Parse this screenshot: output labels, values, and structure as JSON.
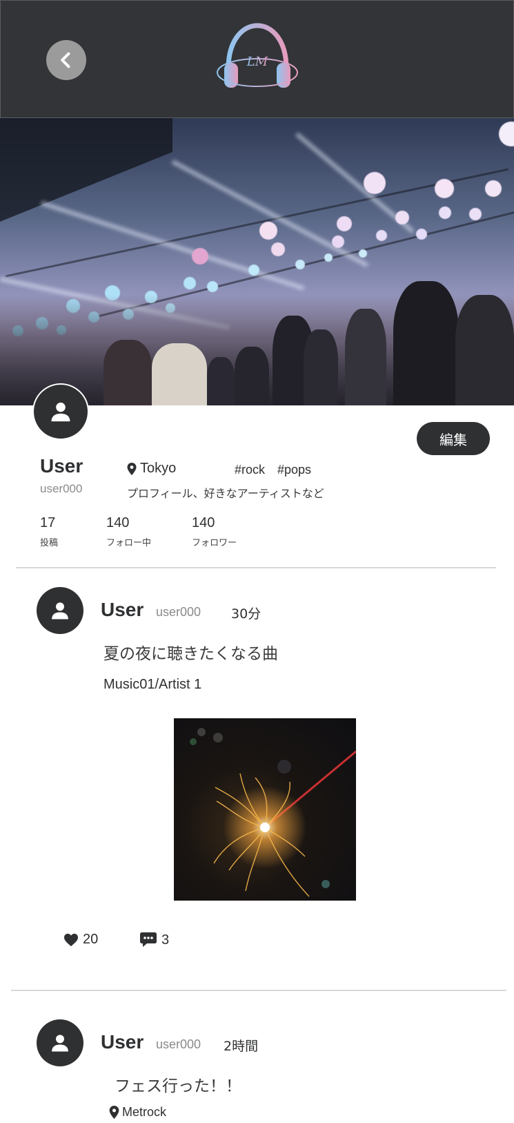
{
  "header": {
    "back_icon": "chevron-left-icon",
    "logo_text": "LM",
    "logo_colors": {
      "blue": "#8ec5f0",
      "pink": "#e79bbd"
    }
  },
  "colors": {
    "header_bg": "#323437",
    "dark": "#2f3032",
    "muted": "#8a8a8a",
    "divider": "#d8d8d8"
  },
  "profile": {
    "name": "User",
    "handle": "user000",
    "location": "Tokyo",
    "tags": [
      "#rock",
      "#pops"
    ],
    "bio": "プロフィール、好きなアーティストなど",
    "edit_label": "編集",
    "stats": [
      {
        "value": "17",
        "label": "投稿"
      },
      {
        "value": "140",
        "label": "フォロー中"
      },
      {
        "value": "140",
        "label": "フォロワー"
      }
    ]
  },
  "posts": [
    {
      "name": "User",
      "handle": "user000",
      "time": "30分",
      "text": "夏の夜に聴きたくなる曲",
      "music": "Music01/Artist 1",
      "likes": "20",
      "comments": "3"
    },
    {
      "name": "User",
      "handle": "user000",
      "time": "2時間",
      "text": "フェス行った！！",
      "location": "Metrock"
    }
  ]
}
